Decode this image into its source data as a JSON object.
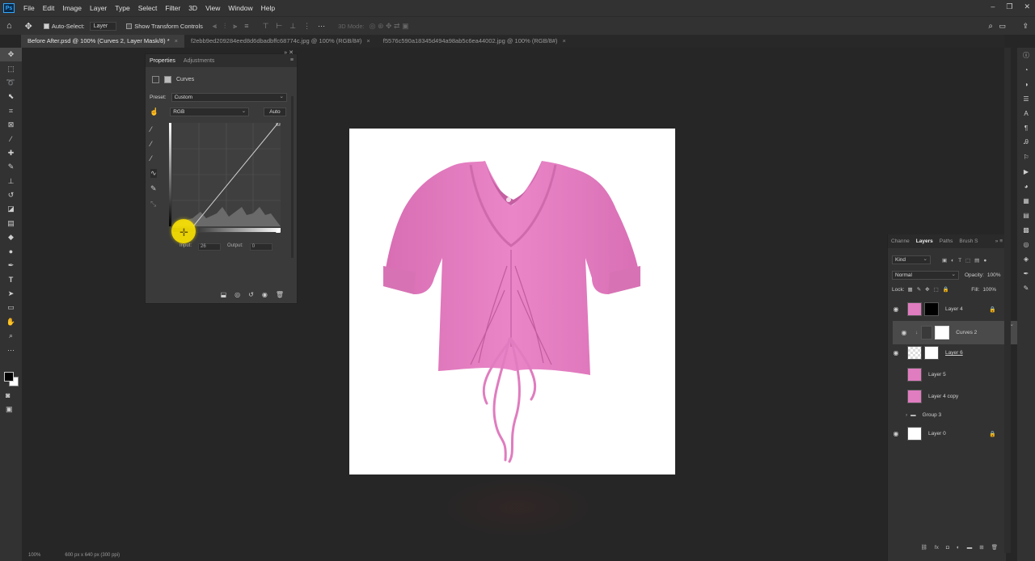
{
  "menubar": {
    "logo": "Ps",
    "items": [
      "File",
      "Edit",
      "Image",
      "Layer",
      "Type",
      "Select",
      "Filter",
      "3D",
      "View",
      "Window",
      "Help"
    ],
    "window_controls": [
      "–",
      "❐",
      "✕"
    ]
  },
  "options_bar": {
    "auto_select_label": "Auto-Select:",
    "auto_select_value": "Layer",
    "transform_label": "Show Transform Controls",
    "mode_3d": "3D Mode:"
  },
  "tabs": [
    {
      "label": "Before After.psd @ 100% (Curves 2, Layer Mask/8) *",
      "active": true
    },
    {
      "label": "f2ebb9ed209284eed8d6dbadbffc68774c.jpg @ 100% (RGB/8#)",
      "active": false
    },
    {
      "label": "f5576c590a18345d494a98ab5c6ea44002.jpg @ 100% (RGB/8#)",
      "active": false
    }
  ],
  "properties": {
    "tab_properties": "Properties",
    "tab_adjustments": "Adjustments",
    "title": "Curves",
    "preset_label": "Preset:",
    "preset_value": "Custom",
    "channel_value": "RGB",
    "auto_label": "Auto",
    "input_label": "Input:",
    "input_value": "26",
    "output_label": "Output:",
    "output_value": "0"
  },
  "layers_panel": {
    "tabs": [
      "Channe",
      "Layers",
      "Paths",
      "Brush S"
    ],
    "kind_label": "Kind",
    "blend_mode": "Normal",
    "opacity_label": "Opacity:",
    "opacity_value": "100%",
    "lock_label": "Lock:",
    "fill_label": "Fill:",
    "fill_value": "100%",
    "layers": [
      {
        "name": "Layer 4",
        "visible": true,
        "thumb": "pink",
        "mask": "mask",
        "locked": true,
        "selected": false
      },
      {
        "name": "Curves 2",
        "visible": true,
        "thumb": "adjust",
        "mask": "white",
        "locked": false,
        "selected": true
      },
      {
        "name": "Layer 6",
        "visible": true,
        "thumb": "checker",
        "mask": "white",
        "locked": false,
        "selected": false
      },
      {
        "name": "Layer 5",
        "visible": false,
        "thumb": "pink",
        "mask": "",
        "locked": false,
        "selected": false
      },
      {
        "name": "Layer 4 copy",
        "visible": false,
        "thumb": "pink",
        "mask": "",
        "locked": false,
        "selected": false
      },
      {
        "name": "Group 3",
        "visible": false,
        "thumb": "folder",
        "mask": "",
        "locked": false,
        "selected": false
      },
      {
        "name": "Layer 0",
        "visible": true,
        "thumb": "white",
        "mask": "",
        "locked": true,
        "selected": false
      }
    ]
  },
  "status": {
    "zoom": "100%",
    "doc_info": "600 px x 640 px (300 ppi)"
  },
  "colors": {
    "shirt": "#e27bbf",
    "accent": "#31a8ff"
  }
}
